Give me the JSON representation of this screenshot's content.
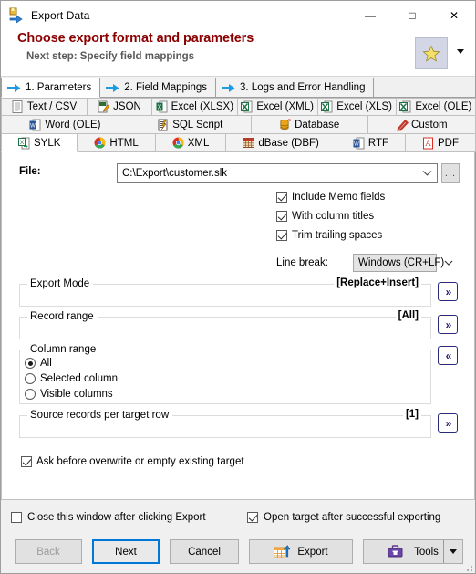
{
  "window": {
    "title": "Export Data",
    "icon": "export-data-icon",
    "caption_buttons": [
      {
        "name": "minimize",
        "glyph": "—"
      },
      {
        "name": "maximize",
        "glyph": "□"
      },
      {
        "name": "close",
        "glyph": "✕"
      }
    ]
  },
  "banner": {
    "title": "Choose export format and parameters",
    "subtitle": "Next step: Specify field mappings",
    "favorite_button": "star-icon",
    "title_color": "#8b0000",
    "subtitle_color": "#5a5a5a"
  },
  "step_tabs": [
    {
      "label": "1. Parameters",
      "active": true
    },
    {
      "label": "2. Field Mappings",
      "active": false
    },
    {
      "label": "3. Logs and Error Handling",
      "active": false
    }
  ],
  "format_tabs": {
    "row1": [
      {
        "label": "Text / CSV",
        "icon": "text-file-icon",
        "active": false
      },
      {
        "label": "JSON",
        "icon": "json-edit-icon",
        "active": false
      },
      {
        "label": "Excel (XLSX)",
        "icon": "excel-icon",
        "active": false
      },
      {
        "label": "Excel (XML)",
        "icon": "excel-xml-icon",
        "active": false
      },
      {
        "label": "Excel (XLS)",
        "icon": "excel-xls-icon",
        "active": false
      },
      {
        "label": "Excel (OLE)",
        "icon": "excel-ole-icon",
        "active": false
      }
    ],
    "row2": [
      {
        "label": "Word (OLE)",
        "icon": "word-icon",
        "active": false
      },
      {
        "label": "SQL Script",
        "icon": "sql-script-icon",
        "active": false
      },
      {
        "label": "Database",
        "icon": "database-icon",
        "active": false
      },
      {
        "label": "Custom",
        "icon": "pencil-icon",
        "active": false
      }
    ],
    "row3": [
      {
        "label": "SYLK",
        "icon": "sylk-icon",
        "active": true
      },
      {
        "label": "HTML",
        "icon": "chrome-icon",
        "active": false
      },
      {
        "label": "XML",
        "icon": "chrome-icon",
        "active": false
      },
      {
        "label": "dBase (DBF)",
        "icon": "dbase-icon",
        "active": false
      },
      {
        "label": "RTF",
        "icon": "word-rtf-icon",
        "active": false
      },
      {
        "label": "PDF",
        "icon": "pdf-icon",
        "active": false
      }
    ]
  },
  "form": {
    "file_label": "File:",
    "file_value": "C:\\Export\\customer.slk",
    "file_placeholder": "",
    "browse_label": "...",
    "checkboxes": [
      {
        "label": "Include Memo fields",
        "checked": true
      },
      {
        "label": "With column titles",
        "checked": true
      },
      {
        "label": "Trim trailing spaces",
        "checked": true
      }
    ],
    "line_break_label": "Line break:",
    "line_break_value": "Windows (CR+LF)",
    "groups": [
      {
        "legend": "Export Mode",
        "value": "[Replace+Insert]",
        "button": "»"
      },
      {
        "legend": "Record range",
        "value": "[All]",
        "button": "»"
      }
    ],
    "column_range": {
      "legend": "Column range",
      "button": "«",
      "options": [
        {
          "label": "All",
          "selected": true
        },
        {
          "label": "Selected column",
          "selected": false
        },
        {
          "label": "Visible columns",
          "selected": false
        }
      ]
    },
    "source_records": {
      "legend": "Source records per target row",
      "value": "[1]",
      "button": "»"
    },
    "ask_overwrite": {
      "label": "Ask before overwrite or empty existing target",
      "checked": true
    }
  },
  "footer": {
    "close_window_cb": {
      "label": "Close this window after clicking Export",
      "checked": false
    },
    "open_target_cb": {
      "label": "Open target after successful exporting",
      "checked": true
    },
    "buttons": {
      "back": "Back",
      "next": "Next",
      "cancel": "Cancel",
      "export": "Export",
      "tools": "Tools"
    }
  }
}
